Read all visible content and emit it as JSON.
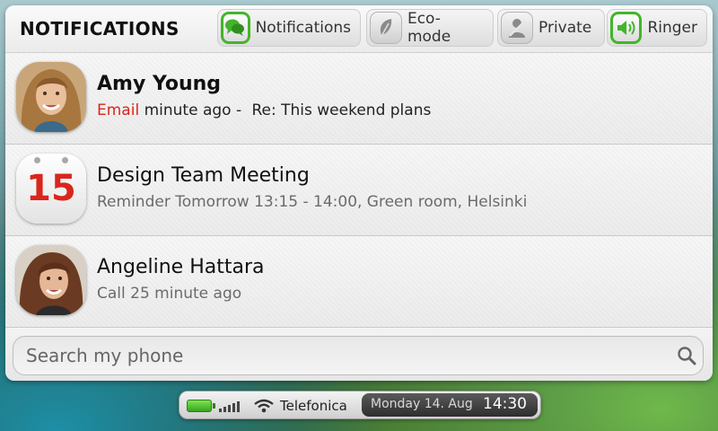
{
  "header": {
    "title": "NOTIFICATIONS",
    "toggles": [
      {
        "label": "Notifications",
        "icon": "speech-bubble-icon",
        "active": true
      },
      {
        "label": "Eco-mode",
        "icon": "leaf-icon",
        "active": false
      },
      {
        "label": "Private",
        "icon": "person-icon",
        "active": false
      },
      {
        "label": "Ringer",
        "icon": "speaker-icon",
        "active": true
      }
    ]
  },
  "notifications": [
    {
      "title": "Amy Young",
      "type": "Email",
      "time": "minute ago -",
      "detail": "Re: This weekend plans",
      "icon": "avatar"
    },
    {
      "title": "Design Team Meeting",
      "subtitle": "Reminder Tomorrow 13:15 - 14:00, Green room, Helsinki",
      "calendar_day": "15",
      "icon": "calendar-icon"
    },
    {
      "title": "Angeline Hattara",
      "subtitle": "Call 25 minute ago",
      "icon": "avatar"
    }
  ],
  "search": {
    "placeholder": "Search my phone"
  },
  "statusbar": {
    "carrier": "Telefonica",
    "date": "Monday 14. Aug",
    "time": "14:30"
  },
  "colors": {
    "accent_green": "#43b52b",
    "highlight_red": "#d9261c"
  }
}
